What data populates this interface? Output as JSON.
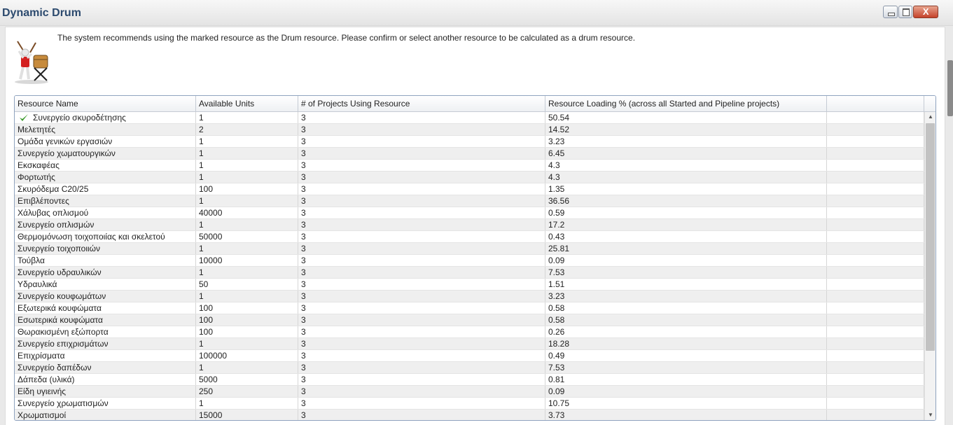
{
  "window": {
    "title": "Dynamic Drum",
    "close_label": "X"
  },
  "message": "The system recommends using the marked resource as the Drum resource. Please confirm or select another resource to be calculated as a drum resource.",
  "icons": {
    "drummer": "drummer-icon",
    "check": "check-icon"
  },
  "table": {
    "columns": [
      "Resource Name",
      "Available Units",
      "# of Projects Using Resource",
      "Resource Loading % (across all Started and Pipeline projects)",
      ""
    ],
    "rows": [
      {
        "name": "Συνεργείο σκυροδέτησης",
        "units": "1",
        "projects": "3",
        "loading": "50.54",
        "marked": true
      },
      {
        "name": "Μελετητές",
        "units": "2",
        "projects": "3",
        "loading": "14.52"
      },
      {
        "name": "Ομάδα γενικών εργασιών",
        "units": "1",
        "projects": "3",
        "loading": "3.23"
      },
      {
        "name": "Συνεργείο χωματουργικών",
        "units": "1",
        "projects": "3",
        "loading": "6.45"
      },
      {
        "name": "Εκσκαφέας",
        "units": "1",
        "projects": "3",
        "loading": "4.3"
      },
      {
        "name": "Φορτωτής",
        "units": "1",
        "projects": "3",
        "loading": "4.3"
      },
      {
        "name": "Σκυρόδεμα C20/25",
        "units": "100",
        "projects": "3",
        "loading": "1.35"
      },
      {
        "name": "Επιβλέποντες",
        "units": "1",
        "projects": "3",
        "loading": "36.56"
      },
      {
        "name": "Χάλυβας οπλισμού",
        "units": "40000",
        "projects": "3",
        "loading": "0.59"
      },
      {
        "name": "Συνεργείο οπλισμών",
        "units": "1",
        "projects": "3",
        "loading": "17.2"
      },
      {
        "name": "Θερμομόνωση τοιχοποιίας και σκελετού",
        "units": "50000",
        "projects": "3",
        "loading": "0.43"
      },
      {
        "name": "Συνεργείο τοιχοποιιών",
        "units": "1",
        "projects": "3",
        "loading": "25.81"
      },
      {
        "name": "Τούβλα",
        "units": "10000",
        "projects": "3",
        "loading": "0.09"
      },
      {
        "name": "Συνεργείο υδραυλικών",
        "units": "1",
        "projects": "3",
        "loading": "7.53"
      },
      {
        "name": "Υδραυλικά",
        "units": "50",
        "projects": "3",
        "loading": "1.51"
      },
      {
        "name": "Συνεργείο κουφωμάτων",
        "units": "1",
        "projects": "3",
        "loading": "3.23"
      },
      {
        "name": "Εξωτερικά κουφώματα",
        "units": "100",
        "projects": "3",
        "loading": "0.58"
      },
      {
        "name": "Εσωτερικά κουφώματα",
        "units": "100",
        "projects": "3",
        "loading": "0.58"
      },
      {
        "name": "Θωρακισμένη εξώπορτα",
        "units": "100",
        "projects": "3",
        "loading": "0.26"
      },
      {
        "name": "Συνεργείο επιχρισμάτων",
        "units": "1",
        "projects": "3",
        "loading": "18.28"
      },
      {
        "name": "Επιχρίσματα",
        "units": "100000",
        "projects": "3",
        "loading": "0.49"
      },
      {
        "name": "Συνεργείο δαπέδων",
        "units": "1",
        "projects": "3",
        "loading": "7.53"
      },
      {
        "name": "Δάπεδα (υλικά)",
        "units": "5000",
        "projects": "3",
        "loading": "0.81"
      },
      {
        "name": "Είδη υγιεινής",
        "units": "250",
        "projects": "3",
        "loading": "0.09"
      },
      {
        "name": "Συνεργείο χρωματισμών",
        "units": "1",
        "projects": "3",
        "loading": "10.75"
      },
      {
        "name": "Χρωματισμοί",
        "units": "15000",
        "projects": "3",
        "loading": "3.73"
      }
    ]
  }
}
